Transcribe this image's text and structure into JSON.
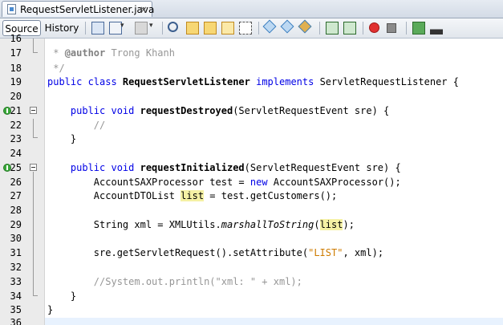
{
  "tab": {
    "title": "RequestServletListener.java",
    "close": "×"
  },
  "toolbar": {
    "source_label": "Source",
    "history_label": "History"
  },
  "lines": {
    "l16": "16",
    "l17": "17",
    "l17_star": " * ",
    "l17_tag": "@author",
    "l17_name": " Trong Khanh",
    "l18": "18",
    "l18_text": " */",
    "l19": "19",
    "l19_kw": "public class ",
    "l19_cls": "RequestServletListener",
    "l19_kw2": " implements ",
    "l19_rest": "ServletRequestListener {",
    "l20": "20",
    "l21": "21",
    "l21_kw": "    public void ",
    "l21_m": "requestDestroyed",
    "l21_rest": "(ServletRequestEvent sre) {",
    "l22": "22",
    "l22_text": "        //",
    "l23": "23",
    "l23_text": "    }",
    "l24": "24",
    "l25": "25",
    "l25_kw": "    public void ",
    "l25_m": "requestInitialized",
    "l25_rest": "(ServletRequestEvent sre) {",
    "l26": "26",
    "l26_a": "        AccountSAXProcessor test = ",
    "l26_kw": "new",
    "l26_b": " AccountSAXProcessor();",
    "l27": "27",
    "l27_a": "        AccountDTOList ",
    "l27_hl": "list",
    "l27_b": " = test.getCustomers();",
    "l28": "28",
    "l29": "29",
    "l29_a": "        String xml = XMLUtils.",
    "l29_it": "marshallToString",
    "l29_p": "(",
    "l29_hl": "list",
    "l29_b": ");",
    "l30": "30",
    "l31": "31",
    "l31_a": "        sre.getServletRequest().setAttribute(",
    "l31_str": "\"LIST\"",
    "l31_b": ", xml);",
    "l32": "32",
    "l33": "33",
    "l33_text": "        //System.out.println(\"xml: \" + xml);",
    "l34": "34",
    "l34_text": "    }",
    "l35": "35",
    "l35_text": "}",
    "l36": "36"
  },
  "colors": {
    "keyword": "#0000e6",
    "comment": "#969696",
    "string": "#ce7b00",
    "highlight": "#f5f1a4"
  }
}
